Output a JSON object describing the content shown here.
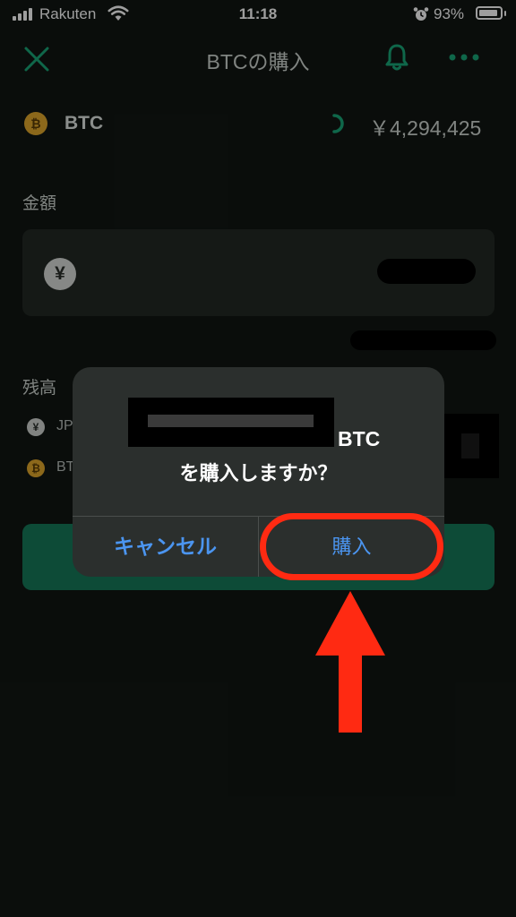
{
  "status_bar": {
    "carrier": "Rakuten",
    "time": "11:18",
    "battery_percent": "93%",
    "battery_level": 0.93,
    "icons": [
      "signal-icon",
      "wifi-icon",
      "alarm-icon",
      "battery-icon"
    ]
  },
  "header": {
    "title": "BTCの購入",
    "close_icon": "close-icon",
    "bell_icon": "bell-icon",
    "more_icon": "more-icon"
  },
  "coin": {
    "symbol_glyph": "₿",
    "name": "BTC",
    "price": "￥4,294,425"
  },
  "form": {
    "amount_label": "金額",
    "currency_glyph": "¥",
    "balance_label": "残高",
    "balances": [
      {
        "glyph": "¥",
        "label": "JP"
      },
      {
        "glyph": "₿",
        "label": "BT"
      }
    ]
  },
  "dialog": {
    "message_suffix": "BTC",
    "message_line2": "を購入しますか？",
    "cancel_label": "キャンセル",
    "confirm_label": "購入"
  },
  "colors": {
    "background": "#111613",
    "accent_green": "#16795a",
    "dialog_button_blue": "#4b95f0",
    "annotation_red": "#ff2a12",
    "btc_orange": "#e3a92c"
  }
}
